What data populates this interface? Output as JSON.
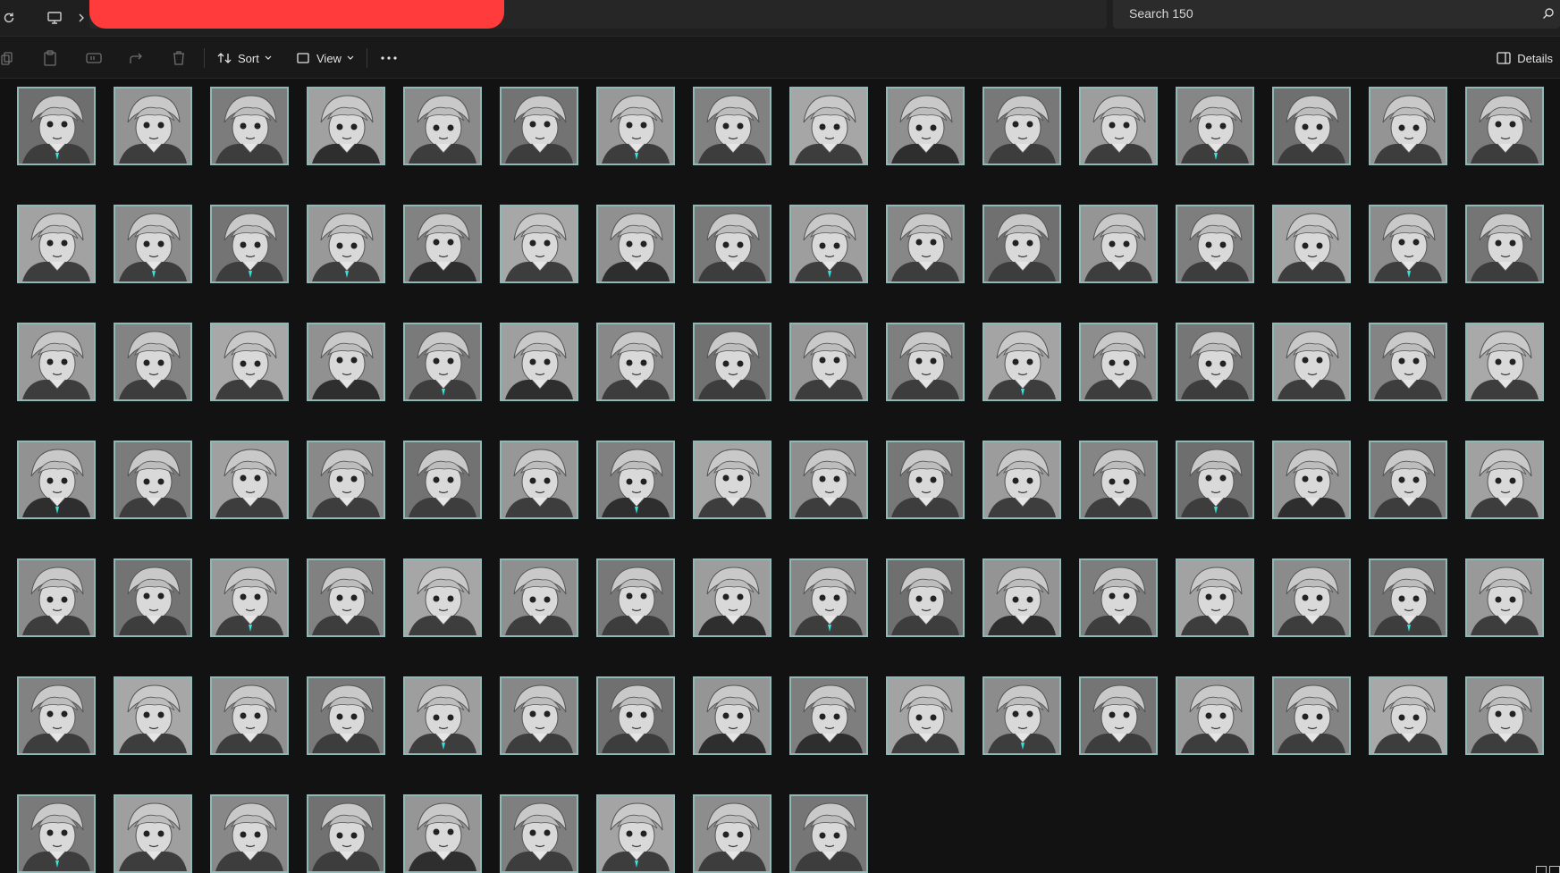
{
  "titlebar": {
    "refresh_icon": "refresh-icon",
    "pc_icon": "this-pc-icon",
    "chevron_icon": "chevron-right-icon",
    "address_redacted_color": "#ff3b3b"
  },
  "search": {
    "text": "Search 150",
    "icon": "search-icon"
  },
  "toolbar": {
    "copy_icon": "copy-icon",
    "paste_icon": "paste-icon",
    "rename_icon": "rename-icon",
    "share_icon": "share-icon",
    "delete_icon": "delete-icon",
    "sort_label": "Sort",
    "view_label": "View",
    "more_icon": "more-icon",
    "details_label": "Details"
  },
  "colors": {
    "thumb_border": "#8fb9b6",
    "thumb_bg": "#8a8a8a",
    "accent_teal": "#2ee8e0"
  },
  "thumbnails": [
    "1",
    "2",
    "3",
    "4",
    "5",
    "6",
    "7",
    "8",
    "9",
    "10",
    "11",
    "12",
    "13",
    "14",
    "15",
    "16",
    "17",
    "18",
    "19",
    "20",
    "21",
    "22",
    "23",
    "24",
    "25",
    "26",
    "27",
    "28",
    "29",
    "30",
    "31",
    "32",
    "33",
    "34",
    "35",
    "36",
    "37",
    "38",
    "39",
    "40",
    "41",
    "42",
    "43",
    "44",
    "45",
    "46",
    "47",
    "48",
    "49",
    "50",
    "51",
    "52",
    "53",
    "54",
    "55",
    "56",
    "57",
    "58",
    "59",
    "60",
    "61",
    "62",
    "63",
    "64",
    "65",
    "66",
    "67",
    "68",
    "69",
    "70",
    "71",
    "72",
    "73",
    "74",
    "75",
    "76",
    "77",
    "78",
    "79",
    "80",
    "81",
    "82",
    "83",
    "84",
    "85",
    "86",
    "87",
    "88",
    "89",
    "90",
    "91",
    "92",
    "93",
    "94",
    "95",
    "96",
    "97",
    "98",
    "99",
    "100",
    "101",
    "102",
    "103",
    "104",
    "105"
  ]
}
